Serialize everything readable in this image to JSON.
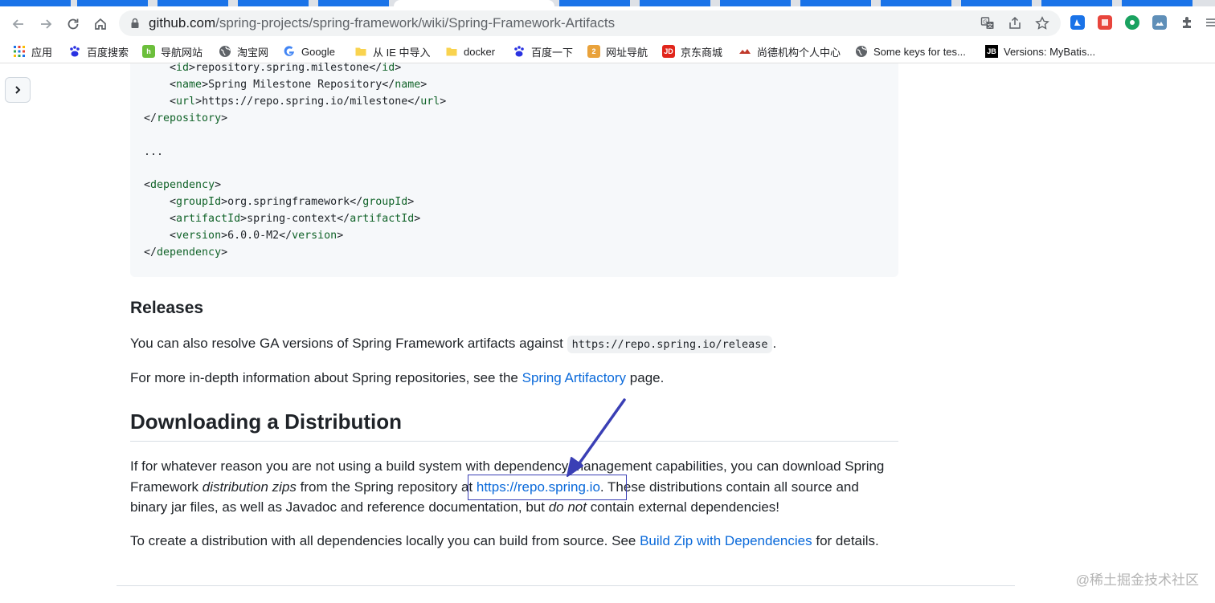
{
  "browser": {
    "url_host": "github.com",
    "url_path": "/spring-projects/spring-framework/wiki/Spring-Framework-Artifacts"
  },
  "bookmarks": [
    {
      "label": "应用",
      "icon": "apps-grid-icon"
    },
    {
      "label": "百度搜索",
      "icon": "baidu-paw-icon"
    },
    {
      "label": "导航网站",
      "icon": "hao123-icon"
    },
    {
      "label": "淘宝网",
      "icon": "globe-icon"
    },
    {
      "label": "Google",
      "icon": "google-g-icon"
    },
    {
      "label": "从 IE 中导入",
      "icon": "folder-icon"
    },
    {
      "label": "docker",
      "icon": "folder-icon"
    },
    {
      "label": "百度一下",
      "icon": "baidu-paw-icon"
    },
    {
      "label": "网址导航",
      "icon": "2345-icon"
    },
    {
      "label": "京东商城",
      "icon": "jd-icon"
    },
    {
      "label": "尚德机构个人中心",
      "icon": "sunlands-icon"
    },
    {
      "label": "Some keys for tes...",
      "icon": "globe-icon"
    },
    {
      "label": "Versions: MyBatis...",
      "icon": "jetbrains-icon"
    }
  ],
  "code": {
    "lines": [
      "    <id>repository.spring.milestone</id>",
      "    <name>Spring Milestone Repository</name>",
      "    <url>https://repo.spring.io/milestone</url>",
      "</repository>",
      "",
      "...",
      "",
      "<dependency>",
      "    <groupId>org.springframework</groupId>",
      "    <artifactId>spring-context</artifactId>",
      "    <version>6.0.0-M2</version>",
      "</dependency>"
    ]
  },
  "releases": {
    "heading": "Releases",
    "p1_text": "You can also resolve GA versions of Spring Framework artifacts against",
    "p1_code": "https://repo.spring.io/release",
    "p1_end": ".",
    "p2_text": "For more in-depth information about Spring repositories, see the",
    "p2_link": "Spring Artifactory",
    "p2_end": "page."
  },
  "distribution": {
    "heading": "Downloading a Distribution",
    "p1_a": "If for whatever reason you are not using a build system with dependency management capabilities, you can download Spring Framework",
    "p1_em": "distribution zips",
    "p1_b": "from the Spring repository at",
    "p1_link": "https://repo.spring.io",
    "p1_c": ". These distributions contain all source and binary jar files, as well as Javadoc and reference documentation, but",
    "p1_em2": "do not",
    "p1_d": "contain external dependencies!",
    "p2_text": "To create a distribution with all dependencies locally you can build from source. See",
    "p2_link": "Build Zip with Dependencies",
    "p2_end": "for details."
  },
  "watermark": "@稀土掘金技术社区",
  "colors": {
    "link": "#0969da",
    "annotation": "#3a3fb5",
    "xml_tag": "#116329"
  }
}
